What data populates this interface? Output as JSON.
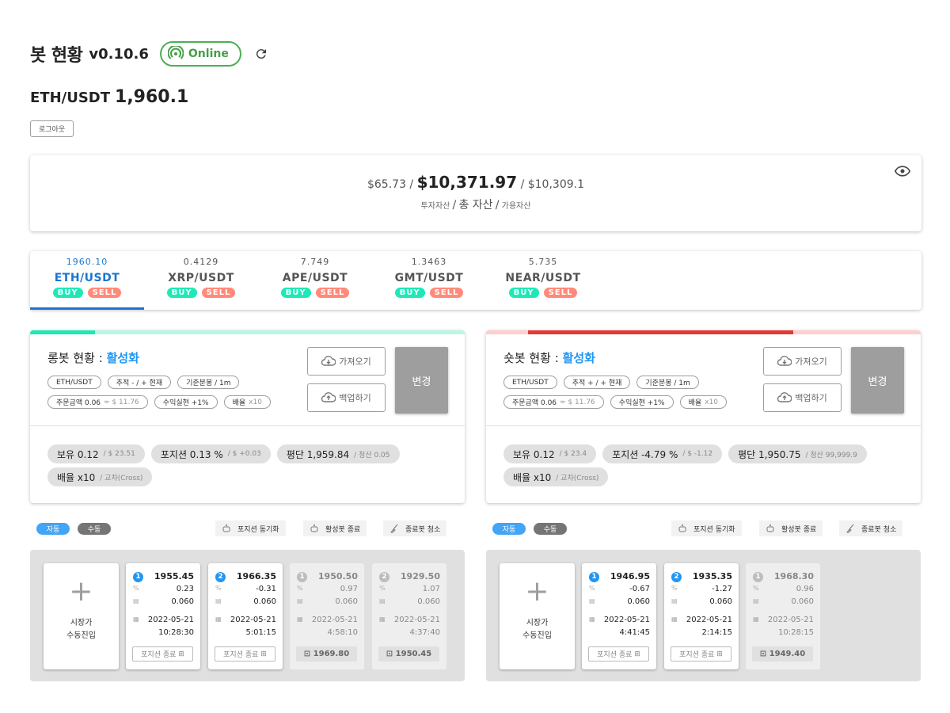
{
  "header": {
    "title": "봇 현황",
    "version": "v0.10.6",
    "status": "Online"
  },
  "pair": {
    "name": "ETH/USDT",
    "price": "1,960.1"
  },
  "logout_label": "로그아웃",
  "assets": {
    "invest": "$65.73 /",
    "total": "$10,371.97",
    "available": "/ $10,309.1",
    "invest_label": "투자자산",
    "sep": "/",
    "total_label": "총 자산",
    "available_label": "가용자산"
  },
  "tabs": [
    {
      "price": "1960.10",
      "name": "ETH/USDT",
      "buy": "BUY",
      "sell": "SELL"
    },
    {
      "price": "0.4129",
      "name": "XRP/USDT",
      "buy": "BUY",
      "sell": "SELL"
    },
    {
      "price": "7.749",
      "name": "APE/USDT",
      "buy": "BUY",
      "sell": "SELL"
    },
    {
      "price": "1.3463",
      "name": "GMT/USDT",
      "buy": "BUY",
      "sell": "SELL"
    },
    {
      "price": "5.735",
      "name": "NEAR/USDT",
      "buy": "BUY",
      "sell": "SELL"
    }
  ],
  "colors": {
    "long_bar": "#1de9b6",
    "long_bar_bg": "#b9f6e6",
    "short_bar": "#e53935",
    "short_bar_bg": "#ffcdd2",
    "accent": "#2196f3"
  },
  "long": {
    "title": "롱봇 현황 : ",
    "status": "활성화",
    "chips": {
      "pair": "ETH/USDT",
      "track": "추적 - / + 현재",
      "candle": "기준분봉 / 1m",
      "order": "주문금액 0.06",
      "order_sub": "≈ $ 11.76",
      "profit": "수익실현 +1%",
      "lev": "배율",
      "lev_sub": "x10"
    },
    "fetch": "가져오기",
    "backup": "백업하기",
    "change": "변경",
    "stats": {
      "hold": "보유 0.12",
      "hold_sub": "/ $ 23.51",
      "pos": "포지션 0.13 %",
      "pos_sub": "/ $ +0.03",
      "avg": "평단 1,959.84",
      "avg_sub": "/ 청산 0.05",
      "lev": "배율 x10",
      "lev_sub": "/ 교차(Cross)"
    },
    "auto": "자동",
    "manual": "수동",
    "sync": "포지션 동기화",
    "stop": "활성봇 종료",
    "clean": "종료봇 청소",
    "manual_entry": [
      "시장가",
      "수동진입"
    ],
    "orders": [
      {
        "n": "1",
        "price": "1955.45",
        "pct": "0.23",
        "qty": "0.060",
        "date": "2022-05-21",
        "time": "10:28:30",
        "action": "포지션 종료"
      },
      {
        "n": "2",
        "price": "1966.35",
        "pct": "-0.31",
        "qty": "0.060",
        "date": "2022-05-21",
        "time": "5:01:15",
        "action": "포지션 종료"
      },
      {
        "n": "1",
        "price": "1950.50",
        "pct": "0.97",
        "qty": "0.060",
        "date": "2022-05-21",
        "time": "4:58:10",
        "action": "1969.80"
      },
      {
        "n": "2",
        "price": "1929.50",
        "pct": "1.07",
        "qty": "0.060",
        "date": "2022-05-21",
        "time": "4:37:40",
        "action": "1950.45"
      }
    ]
  },
  "short": {
    "title": "숏봇 현황 : ",
    "status": "활성화",
    "chips": {
      "pair": "ETH/USDT",
      "track": "추적 + / + 현재",
      "candle": "기준분봉 / 1m",
      "order": "주문금액 0.06",
      "order_sub": "≈ $ 11.76",
      "profit": "수익실현 +1%",
      "lev": "배율",
      "lev_sub": "x10"
    },
    "fetch": "가져오기",
    "backup": "백업하기",
    "change": "변경",
    "stats": {
      "hold": "보유 0.12",
      "hold_sub": "/ $ 23.4",
      "pos": "포지션 -4.79 %",
      "pos_sub": "/ $ -1.12",
      "avg": "평단 1,950.75",
      "avg_sub": "/ 청산 99,999.9",
      "lev": "배율 x10",
      "lev_sub": "/ 교차(Cross)"
    },
    "auto": "자동",
    "manual": "수동",
    "sync": "포지션 동기화",
    "stop": "활성봇 종료",
    "clean": "종료봇 청소",
    "manual_entry": [
      "시장가",
      "수동진입"
    ],
    "orders": [
      {
        "n": "1",
        "price": "1946.95",
        "pct": "-0.67",
        "qty": "0.060",
        "date": "2022-05-21",
        "time": "4:41:45",
        "action": "포지션 종료"
      },
      {
        "n": "2",
        "price": "1935.35",
        "pct": "-1.27",
        "qty": "0.060",
        "date": "2022-05-21",
        "time": "2:14:15",
        "action": "포지션 종료"
      },
      {
        "n": "1",
        "price": "1968.30",
        "pct": "0.96",
        "qty": "0.060",
        "date": "2022-05-21",
        "time": "10:28:15",
        "action": "1949.40"
      }
    ]
  }
}
